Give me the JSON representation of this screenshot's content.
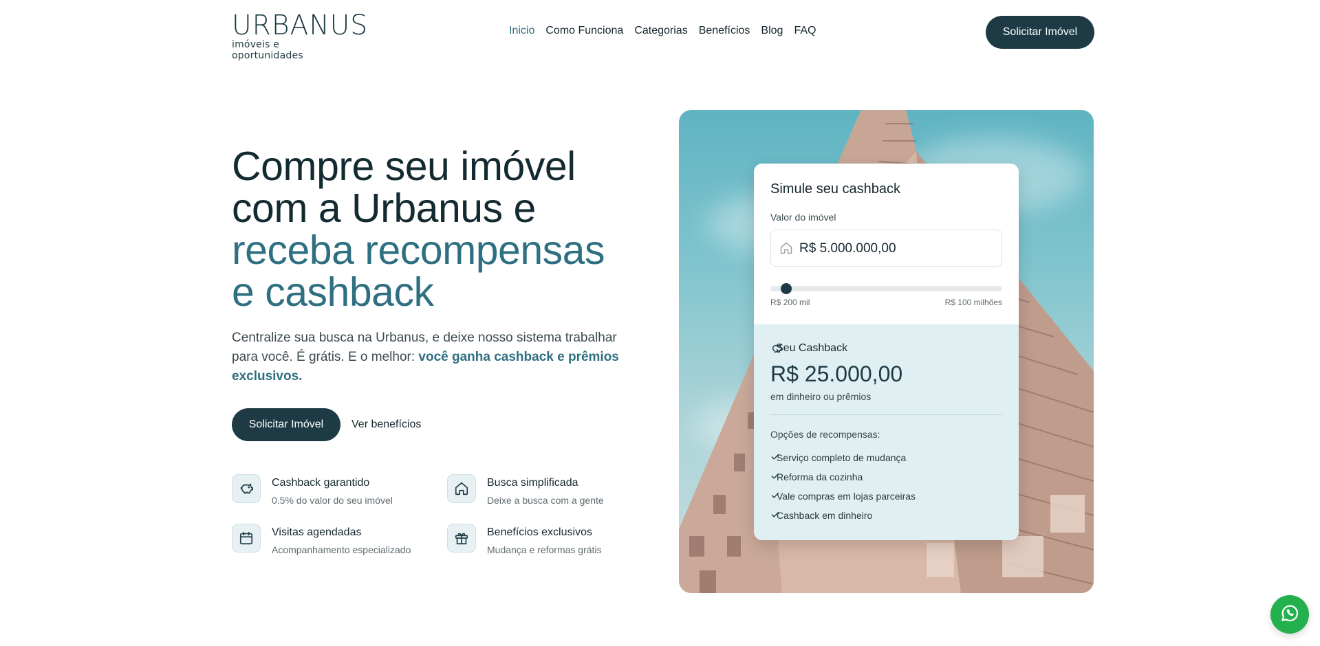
{
  "brand": {
    "name": "URBANUS",
    "tagline": "imóveis e oportunidades"
  },
  "nav": {
    "items": [
      {
        "label": "Inicio",
        "active": true
      },
      {
        "label": "Como Funciona"
      },
      {
        "label": "Categorias"
      },
      {
        "label": "Benefícios"
      },
      {
        "label": "Blog"
      },
      {
        "label": "FAQ"
      }
    ],
    "cta": "Solicitar Imóvel"
  },
  "hero": {
    "title_line1": "Compre seu imóvel",
    "title_line2": "com a Urbanus e",
    "title_accent1": "receba recompensas",
    "title_accent2": "e cashback",
    "subtitle": "Centralize sua busca na Urbanus, e deixe nosso sistema trabalhar para você. É grátis. E o melhor: ",
    "subtitle_strong": "você ganha cashback e prêmios exclusivos.",
    "primary_cta": "Solicitar Imóvel",
    "secondary_link": "Ver benefícios"
  },
  "features": [
    {
      "icon": "piggy-bank-icon",
      "title": "Cashback garantido",
      "desc": "0.5% do valor do seu imóvel"
    },
    {
      "icon": "home-icon",
      "title": "Busca simplificada",
      "desc": "Deixe a busca com a gente"
    },
    {
      "icon": "calendar-icon",
      "title": "Visitas agendadas",
      "desc": "Acompanhamento especializado"
    },
    {
      "icon": "gift-icon",
      "title": "Benefícios exclusivos",
      "desc": "Mudança e reformas grátis"
    }
  ],
  "simulator": {
    "title": "Simule seu cashback",
    "field_label": "Valor do imóvel",
    "field_value": "R$ 5.000.000,00",
    "slider_fraction": 0.048,
    "slider_min_label": "R$ 200 mil",
    "slider_max_label": "R$ 100 milhões",
    "cashback_label": "Seu Cashback",
    "cashback_amount": "R$ 25.000,00",
    "cashback_note": "em dinheiro ou prêmios",
    "options_title": "Opções de recompensas:",
    "options": [
      "Serviço completo de mudança",
      "Reforma da cozinha",
      "Vale compras em lojas parceiras",
      "Cashback em dinheiro"
    ]
  },
  "colors": {
    "primary": "#1e3b45",
    "accent": "#2f6f82",
    "whatsapp": "#22b14c",
    "card_tint": "#e0eff2"
  }
}
